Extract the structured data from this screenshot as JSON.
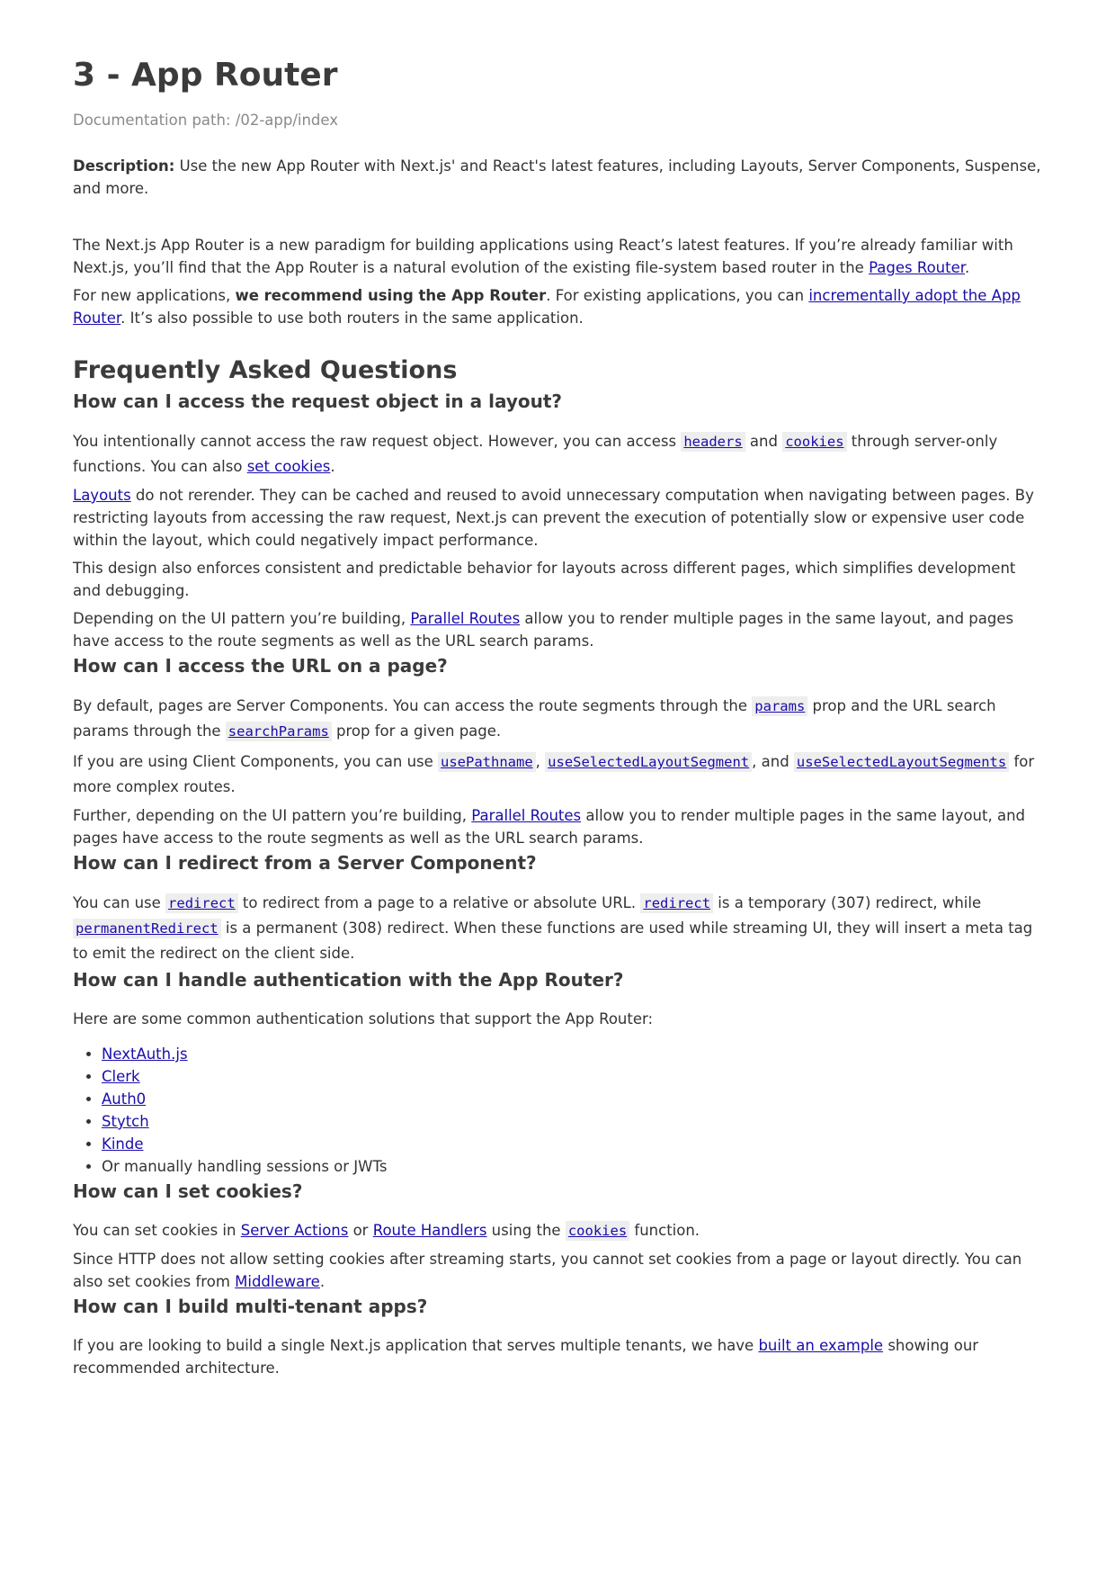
{
  "title": "3 - App Router",
  "path": "Documentation path: /02-app/index",
  "description": {
    "label": "Description:",
    "text": " Use the new App Router with Next.js' and React's latest features, including Layouts, Server Components, Suspense, and more."
  },
  "intro": {
    "p1_text": "The Next.js App Router is a new paradigm for building applications using React’s latest features. If you’re already familiar with Next.js, you’ll find that the App Router is a natural evolution of the existing file-system based router in the ",
    "p1_link": "Pages Router",
    "p1_end": ".",
    "p2_text1": "For new applications, ",
    "p2_bold": "we recommend using the App Router",
    "p2_text2": ". For existing applications, you can ",
    "p2_link": "incrementally adopt the App Router",
    "p2_text3": ". It’s also possible to use both routers in the same application."
  },
  "faq": {
    "heading": "Frequently Asked Questions",
    "q1": {
      "heading": "How can I access the request object in a layout?",
      "p1_a": "You intentionally cannot access the raw request object. However, you can access ",
      "code_headers": "headers",
      "p1_b": " and ",
      "code_cookies": "cookies",
      "p1_c": " through server-only functions. You can also ",
      "link_set_cookies": "set cookies",
      "p1_d": ".",
      "p2_link": "Layouts",
      "p2_text": " do not rerender. They can be cached and reused to avoid unnecessary computation when navigating between pages. By restricting layouts from accessing the raw request, Next.js can prevent the execution of potentially slow or expensive user code within the layout, which could negatively impact performance.",
      "p3": "This design also enforces consistent and predictable behavior for layouts across different pages, which simplifies development and debugging.",
      "p4_a": "Depending on the UI pattern you’re building, ",
      "p4_link": "Parallel Routes",
      "p4_b": " allow you to render multiple pages in the same layout, and pages have access to the route segments as well as the URL search params."
    },
    "q2": {
      "heading": "How can I access the URL on a page?",
      "p1_a": "By default, pages are Server Components. You can access the route segments through the ",
      "code_params": "params",
      "p1_b": " prop and the URL search params through the ",
      "code_searchParams": "searchParams",
      "p1_c": " prop for a given page.",
      "p2_a": "If you are using Client Components, you can use ",
      "code_usePathname": "usePathname",
      "p2_b": ", ",
      "code_useSelectedLayoutSegment": "useSelectedLayoutSegment",
      "p2_c": ", and ",
      "code_useSelectedLayoutSegments": "useSelectedLayoutSegments",
      "p2_d": " for more complex routes.",
      "p3_a": "Further, depending on the UI pattern you’re building, ",
      "p3_link": "Parallel Routes",
      "p3_b": " allow you to render multiple pages in the same layout, and pages have access to the route segments as well as the URL search params."
    },
    "q3": {
      "heading": "How can I redirect from a Server Component?",
      "p1_a": "You can use ",
      "code_redirect1": "redirect",
      "p1_b": " to redirect from a page to a relative or absolute URL. ",
      "code_redirect2": "redirect",
      "p1_c": " is a temporary (307) redirect, while ",
      "code_permanentRedirect": "permanentRedirect",
      "p1_d": " is a permanent (308) redirect. When these functions are used while streaming UI, they will insert a meta tag to emit the redirect on the client side."
    },
    "q4": {
      "heading": "How can I handle authentication with the App Router?",
      "intro": "Here are some common authentication solutions that support the App Router:",
      "items": [
        "NextAuth.js",
        "Clerk",
        "Auth0",
        "Stytch",
        "Kinde"
      ],
      "last_item": "Or manually handling sessions or JWTs"
    },
    "q5": {
      "heading": "How can I set cookies?",
      "p1_a": "You can set cookies in ",
      "link_server_actions": "Server Actions",
      "p1_b": " or ",
      "link_route_handlers": "Route Handlers",
      "p1_c": " using the ",
      "code_cookies": "cookies",
      "p1_d": " function.",
      "p2_a": "Since HTTP does not allow setting cookies after streaming starts, you cannot set cookies from a page or layout directly. You can also set cookies from ",
      "p2_link": "Middleware",
      "p2_b": "."
    },
    "q6": {
      "heading": "How can I build multi-tenant apps?",
      "p1_a": "If you are looking to build a single Next.js application that serves multiple tenants, we have ",
      "p1_link": "built an example",
      "p1_b": " showing our recommended architecture."
    }
  }
}
